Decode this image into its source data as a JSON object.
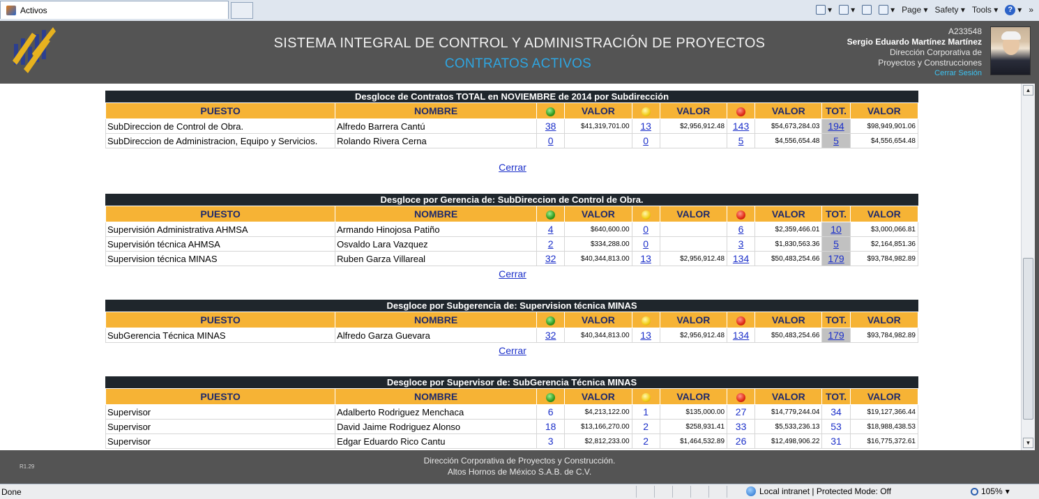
{
  "browser": {
    "tab_title": "Activos",
    "commands": {
      "page": "Page ▾",
      "safety": "Safety ▾",
      "tools": "Tools ▾",
      "help": "?",
      "more": "»"
    },
    "status": "Done",
    "zone": "Local intranet | Protected Mode: Off",
    "zoom": "105%"
  },
  "header": {
    "title": "SISTEMA INTEGRAL DE CONTROL Y ADMINISTRACIÓN DE PROYECTOS",
    "subtitle": "CONTRATOS ACTIVOS",
    "user": {
      "id": "A233548",
      "name": "Sergio Eduardo Martínez Martínez",
      "dept_line1": "Dirección Corporativa de",
      "dept_line2": "Proyectos y Construcciones",
      "logout": "Cerrar Sesión"
    }
  },
  "columns": [
    "PUESTO",
    "NOMBRE",
    "VALOR",
    "VALOR",
    "VALOR",
    "TOT.",
    "VALOR"
  ],
  "status_colors": {
    "green": "#2f9a1f",
    "yellow": "#f2cc16",
    "red": "#e02a16"
  },
  "close_label": "Cerrar",
  "sections": [
    {
      "title": "Desgloce de Contratos TOTAL en NOVIEMBRE de 2014 por Subdirección",
      "rows": [
        {
          "puesto": "SubDireccion de Control de Obra.",
          "nombre": "Alfredo Barrera Cantú",
          "g": "38",
          "gv": "$41,319,701.00",
          "y": "13",
          "yv": "$2,956,912.48",
          "r": "143",
          "rv": "$54,673,284.03",
          "t": "194",
          "tv": "$98,949,901.06"
        },
        {
          "puesto": "SubDireccion de Administracion, Equipo y Servicios.",
          "nombre": "Rolando Rivera Cerna",
          "g": "0",
          "gv": "",
          "y": "0",
          "yv": "",
          "r": "5",
          "rv": "$4,556,654.48",
          "t": "5",
          "tv": "$4,556,654.48"
        }
      ]
    },
    {
      "title": "Desgloce por Gerencia de: SubDireccion de Control de Obra.",
      "rows": [
        {
          "puesto": "Supervisión Administrativa AHMSA",
          "nombre": "Armando Hinojosa Patiño",
          "g": "4",
          "gv": "$640,600.00",
          "y": "0",
          "yv": "",
          "r": "6",
          "rv": "$2,359,466.01",
          "t": "10",
          "tv": "$3,000,066.81"
        },
        {
          "puesto": "Supervisión técnica AHMSA",
          "nombre": "Osvaldo Lara Vazquez",
          "g": "2",
          "gv": "$334,288.00",
          "y": "0",
          "yv": "",
          "r": "3",
          "rv": "$1,830,563.36",
          "t": "5",
          "tv": "$2,164,851.36"
        },
        {
          "puesto": "Supervision técnica MINAS",
          "nombre": "Ruben Garza Villareal",
          "g": "32",
          "gv": "$40,344,813.00",
          "y": "13",
          "yv": "$2,956,912.48",
          "r": "134",
          "rv": "$50,483,254.66",
          "t": "179",
          "tv": "$93,784,982.89"
        }
      ]
    },
    {
      "title": "Desgloce por Subgerencia de: Supervision técnica MINAS",
      "rows": [
        {
          "puesto": "SubGerencia Técnica MINAS",
          "nombre": "Alfredo Garza Guevara",
          "g": "32",
          "gv": "$40,344,813.00",
          "y": "13",
          "yv": "$2,956,912.48",
          "r": "134",
          "rv": "$50,483,254.66",
          "t": "179",
          "tv": "$93,784,982.89"
        }
      ]
    },
    {
      "title": "Desgloce por Supervisor de: SubGerencia Técnica MINAS",
      "rows": [
        {
          "puesto": "Supervisor",
          "nombre": "Adalberto Rodriguez Menchaca",
          "g": "6",
          "gv": "$4,213,122.00",
          "y": "1",
          "yv": "$135,000.00",
          "r": "27",
          "rv": "$14,779,244.04",
          "t": "34",
          "tv": "$19,127,366.44"
        },
        {
          "puesto": "Supervisor",
          "nombre": "David Jaime Rodriguez Alonso",
          "g": "18",
          "gv": "$13,166,270.00",
          "y": "2",
          "yv": "$258,931.41",
          "r": "33",
          "rv": "$5,533,236.13",
          "t": "53",
          "tv": "$18,988,438.53"
        },
        {
          "puesto": "Supervisor",
          "nombre": "Edgar Eduardo Rico Cantu",
          "g": "3",
          "gv": "$2,812,233.00",
          "y": "2",
          "yv": "$1,464,532.89",
          "r": "26",
          "rv": "$12,498,906.22",
          "t": "31",
          "tv": "$16,775,372.61"
        }
      ]
    }
  ],
  "footer": {
    "version": "R1.29",
    "line1": "Dirección Corporativa de Proyectos y Construcción.",
    "line2": "Altos Hornos de México S.A.B. de C.V."
  }
}
